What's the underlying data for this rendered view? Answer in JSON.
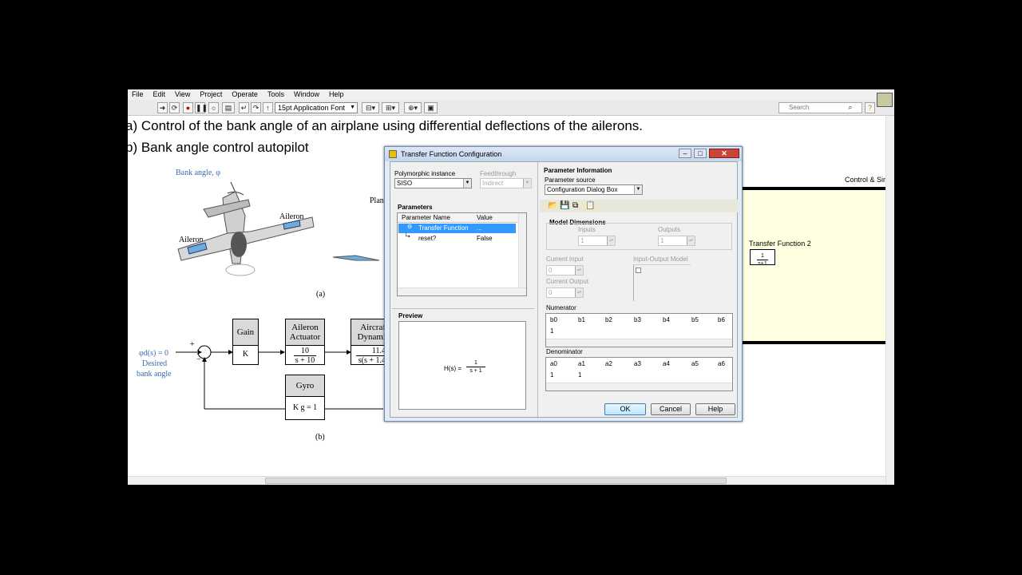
{
  "menu": [
    "File",
    "Edit",
    "View",
    "Project",
    "Operate",
    "Tools",
    "Window",
    "Help"
  ],
  "toolbar": {
    "font": "15pt Application Font",
    "search_placeholder": "Search"
  },
  "slide": {
    "line_a": "a) Control of the bank angle of an airplane using differential deflections of the ailerons.",
    "line_b": "b) Bank angle control autopilot"
  },
  "figure_a": {
    "bank_angle": "Bank angle, φ",
    "aileron_right": "Aileron",
    "aileron_left": "Aileron",
    "plane_partial": "Plan",
    "label": "(a)"
  },
  "figure_b": {
    "input_var": "φd(s) = 0",
    "input_desc": "Desired",
    "input_desc2": "bank angle",
    "plus": "+",
    "minus": "−",
    "gain_title": "Gain",
    "gain_body": "K",
    "actuator_title1": "Aileron",
    "actuator_title2": "Actuator",
    "actuator_num": "10",
    "actuator_den": "s + 10",
    "aircraft_title1": "Aircraf",
    "aircraft_title2": "Dynami",
    "aircraft_num": "11.4",
    "aircraft_den": "s(s + 1.4",
    "gyro_title": "Gyro",
    "gyro_body": "K g = 1",
    "label": "(b)"
  },
  "right_panel": {
    "control_sim": "Control & Sim",
    "tf2_label": "Transfer Function 2",
    "tf2_num": "1",
    "tf2_den": "s+1"
  },
  "dialog": {
    "title": "Transfer Function Configuration",
    "poly_label": "Polymorphic instance",
    "poly_value": "SISO",
    "feed_label": "Feedthrough",
    "feed_value": "Indirect",
    "params_label": "Parameters",
    "col_name": "Parameter Name",
    "col_value": "Value",
    "params": [
      {
        "name": "Transfer Function",
        "value": "...",
        "selected": true
      },
      {
        "name": "reset?",
        "value": "False",
        "selected": false
      }
    ],
    "preview_label": "Preview",
    "preview_lhs": "H(s) =",
    "preview_num": "1",
    "preview_den": "s + 1",
    "param_info": "Parameter Information",
    "param_source_label": "Parameter source",
    "param_source_value": "Configuration Dialog Box",
    "model_dims": "Model Dimensions",
    "inputs_label": "Inputs",
    "inputs_value": "1",
    "outputs_label": "Outputs",
    "outputs_value": "1",
    "cur_input_label": "Current Input",
    "cur_input_value": "0",
    "cur_output_label": "Current Output",
    "cur_output_value": "0",
    "io_model_label": "Input-Output Model",
    "numerator_label": "Numerator",
    "num_headers": [
      "b0",
      "b1",
      "b2",
      "b3",
      "b4",
      "b5",
      "b6"
    ],
    "num_values": [
      "1"
    ],
    "denominator_label": "Denominator",
    "den_headers": [
      "a0",
      "a1",
      "a2",
      "a3",
      "a4",
      "a5",
      "a6"
    ],
    "den_values": [
      "1",
      "1"
    ],
    "ok": "OK",
    "cancel": "Cancel",
    "help": "Help"
  }
}
